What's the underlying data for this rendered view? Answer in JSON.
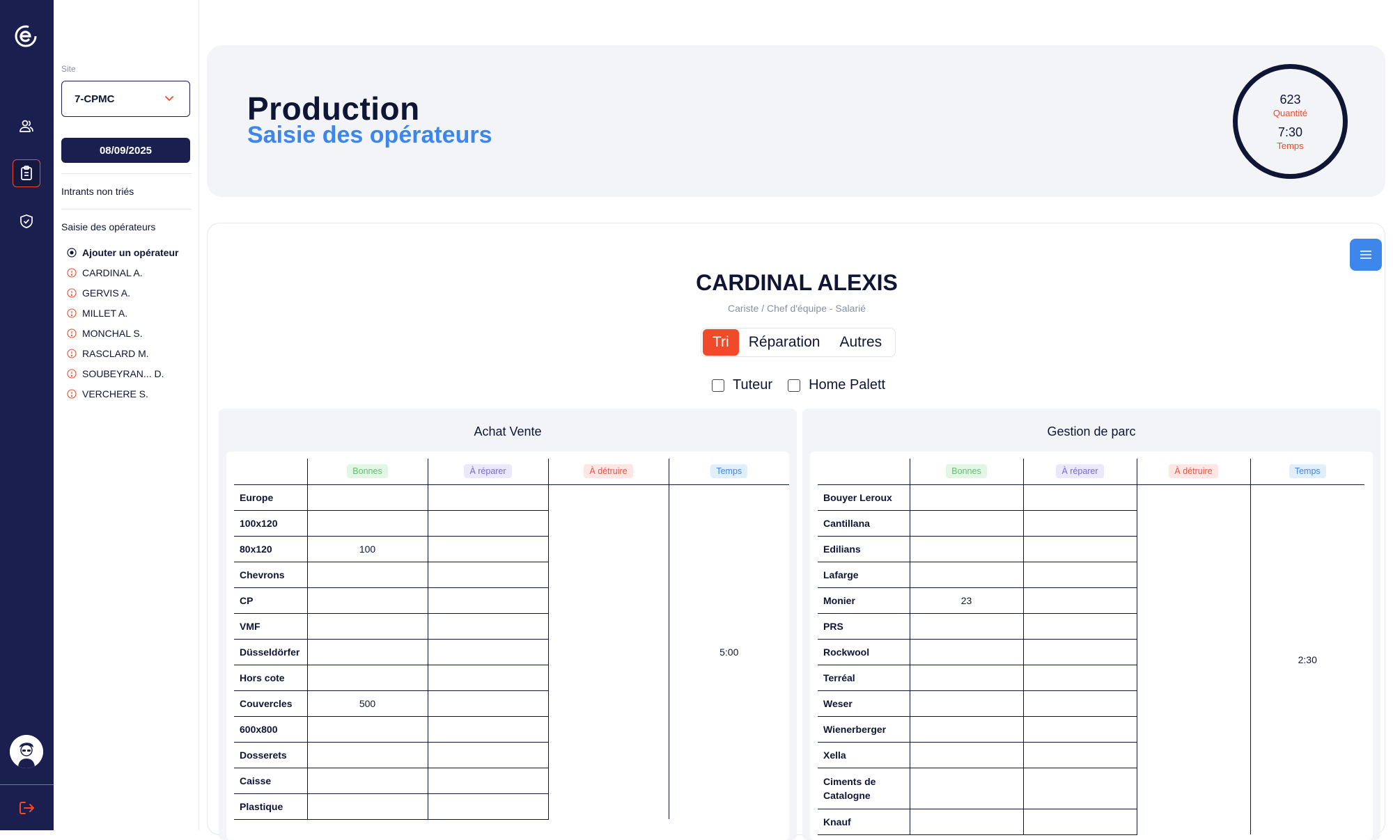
{
  "sidebar": {
    "site_label": "Site",
    "site_value": "7-CPMC",
    "date": "08/09/2025",
    "intrants_label": "Intrants non triés",
    "saisie_label": "Saisie des opérateurs",
    "add_operator": "Ajouter un opérateur",
    "operators": [
      "CARDINAL A.",
      "GERVIS A.",
      "MILLET A.",
      "MONCHAL S.",
      "RASCLARD M.",
      "SOUBEYRAN... D.",
      "VERCHERE S."
    ]
  },
  "header": {
    "title": "Production",
    "subtitle": "Saisie des opérateurs",
    "quantity_value": "623",
    "quantity_label": "Quantité",
    "time_value": "7:30",
    "time_label": "Temps"
  },
  "operator": {
    "name": "CARDINAL ALEXIS",
    "role": "Cariste / Chef d'équipe - Salarié"
  },
  "tabs": [
    "Tri",
    "Réparation",
    "Autres"
  ],
  "active_tab": "Tri",
  "checkboxes": [
    {
      "label": "Tuteur",
      "checked": false
    },
    {
      "label": "Home Palett",
      "checked": false
    }
  ],
  "columns": {
    "bonnes": "Bonnes",
    "reparer": "À réparer",
    "detruire": "À détruire",
    "temps": "Temps"
  },
  "panels": {
    "achat_vente": {
      "title": "Achat Vente",
      "rows": [
        {
          "label": "Europe",
          "bonnes": "",
          "reparer": ""
        },
        {
          "label": "100x120",
          "bonnes": "",
          "reparer": ""
        },
        {
          "label": "80x120",
          "bonnes": "100",
          "reparer": ""
        },
        {
          "label": "Chevrons",
          "bonnes": "",
          "reparer": ""
        },
        {
          "label": "CP",
          "bonnes": "",
          "reparer": ""
        },
        {
          "label": "VMF",
          "bonnes": "",
          "reparer": ""
        },
        {
          "label": "Düsseldörfer",
          "bonnes": "",
          "reparer": ""
        },
        {
          "label": "Hors cote",
          "bonnes": "",
          "reparer": ""
        },
        {
          "label": "Couvercles",
          "bonnes": "500",
          "reparer": ""
        },
        {
          "label": "600x800",
          "bonnes": "",
          "reparer": ""
        },
        {
          "label": "Dosserets",
          "bonnes": "",
          "reparer": ""
        },
        {
          "label": "Caisse",
          "bonnes": "",
          "reparer": ""
        },
        {
          "label": "Plastique",
          "bonnes": "",
          "reparer": ""
        }
      ],
      "temps": "5:00"
    },
    "gestion_parc": {
      "title": "Gestion de parc",
      "rows": [
        {
          "label": "Bouyer Leroux",
          "bonnes": "",
          "reparer": ""
        },
        {
          "label": "Cantillana",
          "bonnes": "",
          "reparer": ""
        },
        {
          "label": "Edilians",
          "bonnes": "",
          "reparer": ""
        },
        {
          "label": "Lafarge",
          "bonnes": "",
          "reparer": ""
        },
        {
          "label": "Monier",
          "bonnes": "23",
          "reparer": ""
        },
        {
          "label": "PRS",
          "bonnes": "",
          "reparer": ""
        },
        {
          "label": "Rockwool",
          "bonnes": "",
          "reparer": ""
        },
        {
          "label": "Terréal",
          "bonnes": "",
          "reparer": ""
        },
        {
          "label": "Weser",
          "bonnes": "",
          "reparer": ""
        },
        {
          "label": "Wienerberger",
          "bonnes": "",
          "reparer": ""
        },
        {
          "label": "Xella",
          "bonnes": "",
          "reparer": ""
        },
        {
          "label": "Ciments de Catalogne",
          "bonnes": "",
          "reparer": ""
        },
        {
          "label": "Knauf",
          "bonnes": "",
          "reparer": ""
        }
      ],
      "temps": "2:30"
    }
  },
  "colors": {
    "navy": "#1b1f4f",
    "accent_orange": "#f04a2a",
    "accent_blue": "#3d86ec"
  },
  "icons": [
    "logo-icon",
    "users-icon",
    "clipboard-icon",
    "shield-check-icon",
    "avatar",
    "logout-icon",
    "chevron-down-icon",
    "plus-circle-icon",
    "alert-circle-icon",
    "menu-icon"
  ]
}
